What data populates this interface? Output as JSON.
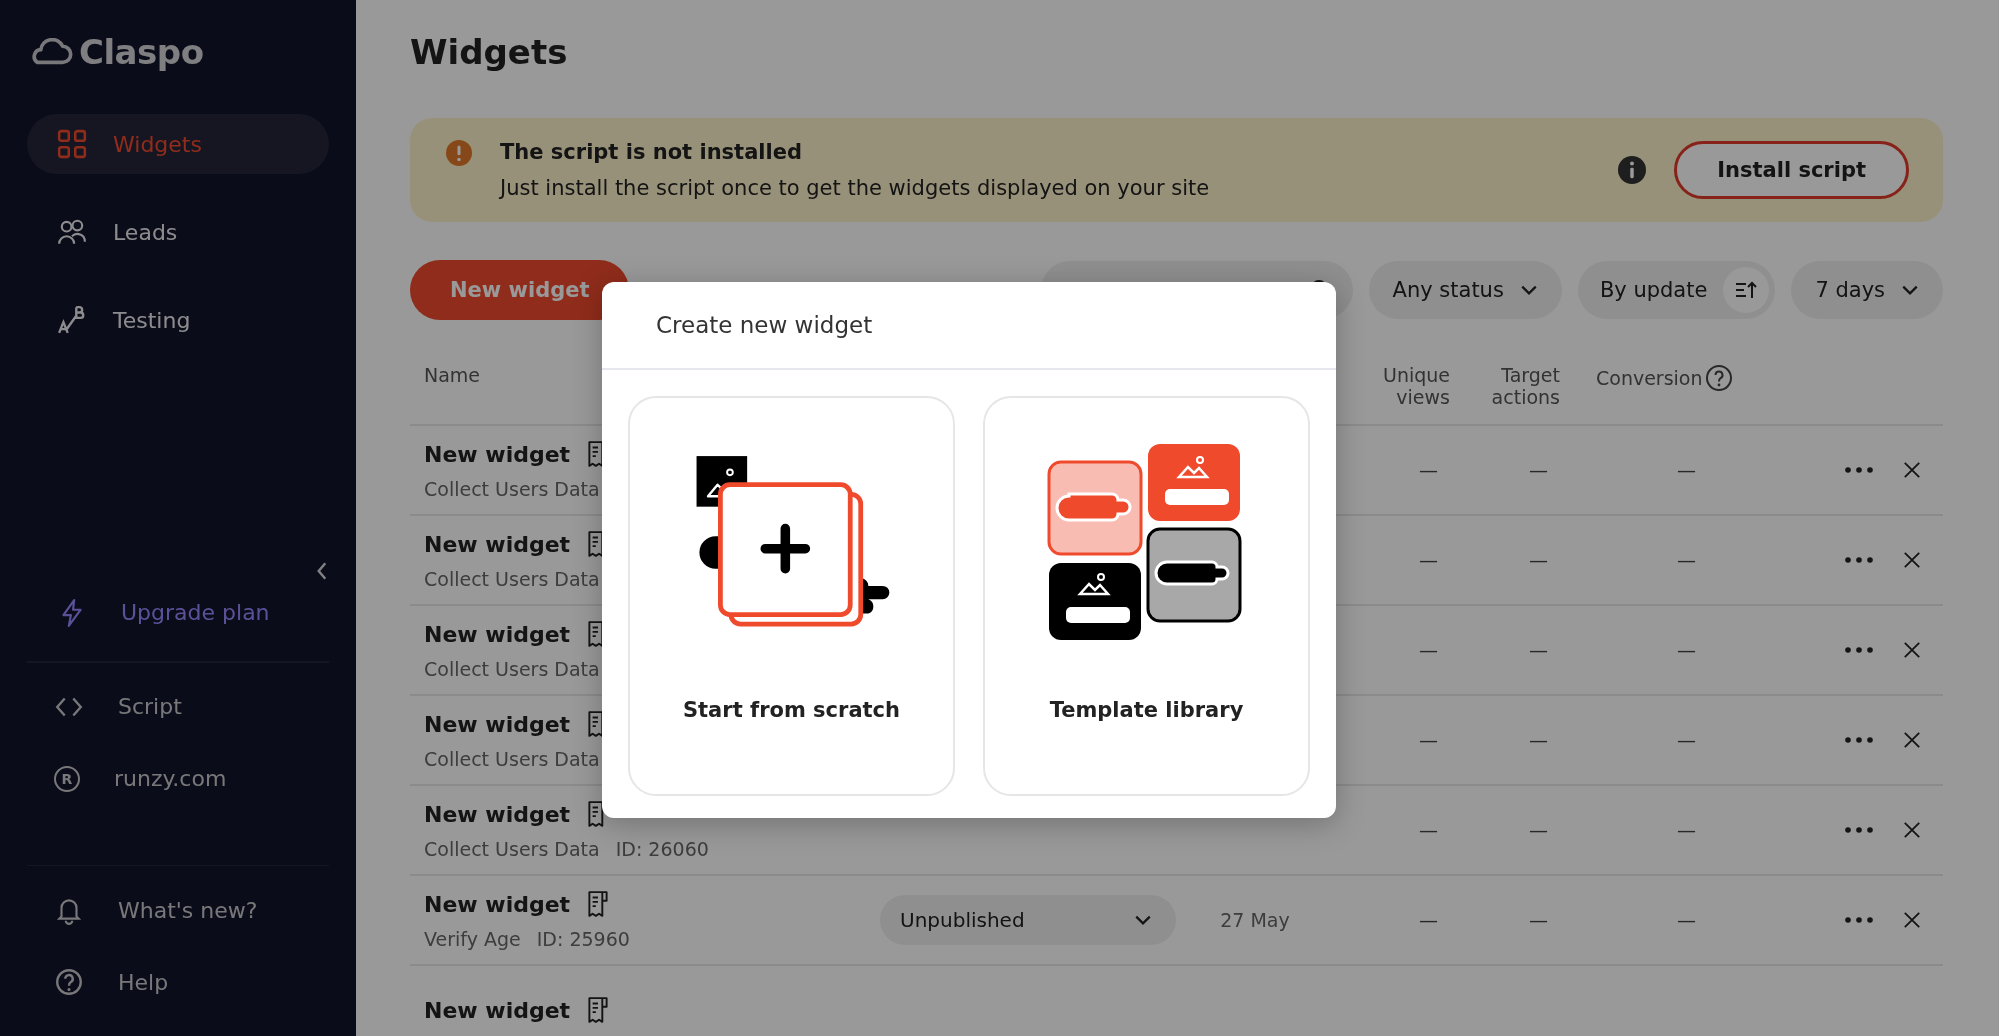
{
  "sidebar": {
    "logo": "Claspo",
    "nav": [
      {
        "label": "Widgets",
        "kind": "grid",
        "selected": true
      },
      {
        "label": "Leads",
        "kind": "users",
        "selected": false
      },
      {
        "label": "Testing",
        "kind": "ab",
        "selected": false
      }
    ],
    "upgrade": "Upgrade plan",
    "links": [
      {
        "label": "Script",
        "kind": "code"
      },
      {
        "label": "runzy.com",
        "kind": "registered",
        "mark": "R"
      }
    ],
    "footer": [
      {
        "label": "What's new?",
        "kind": "bell"
      },
      {
        "label": "Help",
        "kind": "help"
      }
    ]
  },
  "page_title": "Widgets",
  "alert": {
    "title": "The script is not installed",
    "text": "Just install the script once to get the widgets displayed on your site",
    "button": "Install script"
  },
  "toolbar": {
    "new_button": "New widget",
    "status_filter": "Any status",
    "sort": "By update",
    "period": "7 days"
  },
  "table": {
    "columns": [
      "Name",
      "Unique views",
      "Target actions",
      "Conversion"
    ],
    "rows": [
      {
        "name": "New widget",
        "type": "Collect Users Data",
        "unique_views": "—",
        "target_actions": "—",
        "conversion": "—"
      },
      {
        "name": "New widget",
        "type": "Collect Users Data",
        "unique_views": "—",
        "target_actions": "—",
        "conversion": "—"
      },
      {
        "name": "New widget",
        "type": "Collect Users Data",
        "unique_views": "—",
        "target_actions": "—",
        "conversion": "—"
      },
      {
        "name": "New widget",
        "type": "Collect Users Data",
        "unique_views": "—",
        "target_actions": "—",
        "conversion": "—"
      },
      {
        "name": "New widget",
        "type": "Collect Users Data",
        "id": "ID: 26060",
        "unique_views": "—",
        "target_actions": "—",
        "conversion": "—"
      },
      {
        "name": "New widget",
        "type": "Verify Age",
        "id": "ID: 25960",
        "status": "Unpublished",
        "date": "27 May",
        "unique_views": "—",
        "target_actions": "—",
        "conversion": "—"
      },
      {
        "name": "New widget"
      }
    ]
  },
  "modal": {
    "title": "Create new widget",
    "options": [
      {
        "label": "Start from scratch",
        "kind": "scratch"
      },
      {
        "label": "Template library",
        "kind": "templates"
      }
    ]
  }
}
